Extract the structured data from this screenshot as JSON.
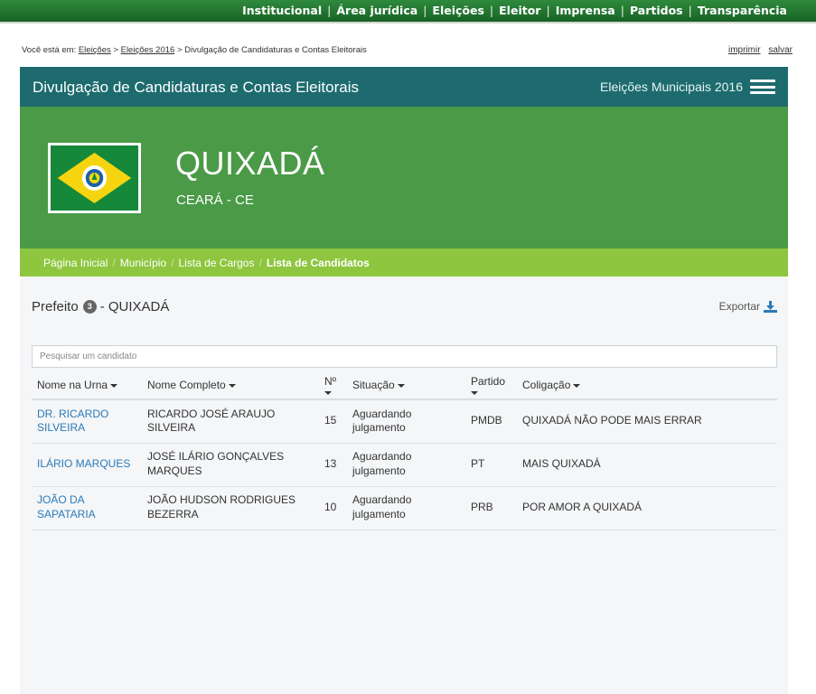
{
  "topnav": {
    "items": [
      "Institucional",
      "Área jurídica",
      "Eleições",
      "Eleitor",
      "Imprensa",
      "Partidos",
      "Transparência"
    ],
    "separator": "|"
  },
  "location": {
    "prefix": "Você está em:",
    "items": [
      "Eleições",
      "Eleições 2016",
      "Divulgação de Candidaturas e Contas Eleitorais"
    ],
    "separator": ">"
  },
  "actions": {
    "print": "imprimir",
    "save": "salvar"
  },
  "header": {
    "title": "Divulgação de Candidaturas e Contas Eleitorais",
    "election": "Eleições Municipais 2016"
  },
  "hero": {
    "city": "QUIXADÁ",
    "state": "CEARÁ - CE"
  },
  "breadcrumb": {
    "items": [
      "Página Inicial",
      "Município",
      "Lista de Cargos",
      "Lista de Candidatos"
    ],
    "separator": "/"
  },
  "section": {
    "office": "Prefeito",
    "count": "3",
    "dash": "- QUIXADÁ",
    "export": "Exportar"
  },
  "search": {
    "placeholder": "Pesquisar um candidato",
    "value": ""
  },
  "table": {
    "headers": [
      "Nome na Urna",
      "Nome Completo",
      "Nº",
      "Situação",
      "Partido",
      "Coligação"
    ],
    "rows": [
      {
        "ballot_name": "DR. RICARDO SILVEIRA",
        "full_name": "RICARDO JOSÉ ARAUJO SILVEIRA",
        "number": "15",
        "status": "Aguardando julgamento",
        "party": "PMDB",
        "coalition": "QUIXADÁ NÃO PODE MAIS ERRAR"
      },
      {
        "ballot_name": "ILÁRIO MARQUES",
        "full_name": "JOSÉ ILÁRIO GONÇALVES MARQUES",
        "number": "13",
        "status": "Aguardando julgamento",
        "party": "PT",
        "coalition": "MAIS QUIXADÁ"
      },
      {
        "ballot_name": "JOÃO DA SAPATARIA",
        "full_name": "JOÃO HUDSON RODRIGUES BEZERRA",
        "number": "10",
        "status": "Aguardando julgamento",
        "party": "PRB",
        "coalition": "POR AMOR A QUIXADÁ"
      }
    ]
  },
  "colors": {
    "nav_green": "#1f6f2d",
    "header_teal": "#1d6b6e",
    "hero_green": "#4a9a47",
    "crumb_lime": "#8ec63f",
    "link_blue": "#2a7ab8"
  },
  "icons": {
    "menu": "hamburger-menu-icon",
    "export": "download-icon",
    "flag": "ceara-flag"
  }
}
